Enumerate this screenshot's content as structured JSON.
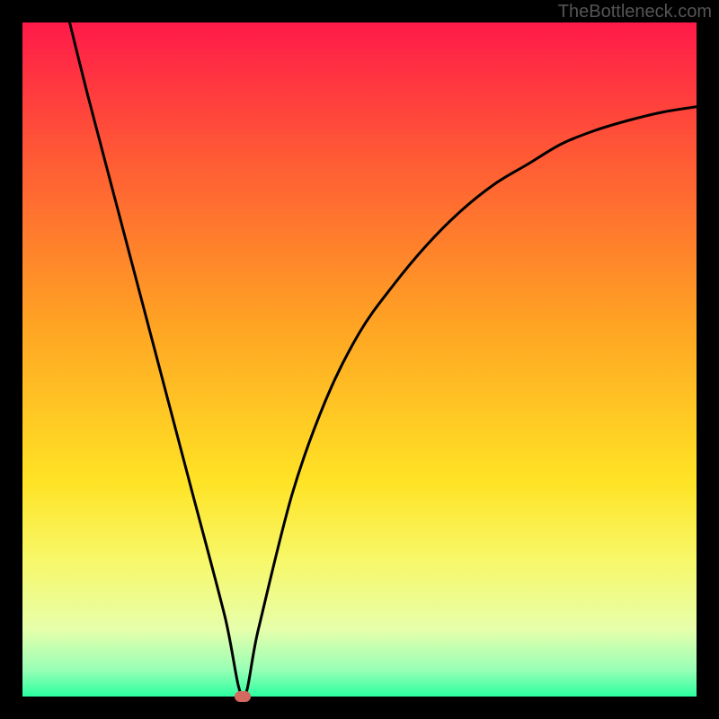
{
  "credit": "TheBottleneck.com",
  "colors": {
    "gradient": [
      "#ff1a49",
      "#ff5a35",
      "#ffa423",
      "#ffe325",
      "#f7f86a",
      "#e7ffab",
      "#99ffb6",
      "#2bffa0"
    ],
    "curve": "#000000",
    "marker": "#d46a5f",
    "background": "#000000"
  },
  "chart_data": {
    "type": "line",
    "title": "",
    "xlabel": "",
    "ylabel": "",
    "xlim": [
      0,
      1
    ],
    "ylim": [
      0,
      1
    ],
    "series": [
      {
        "name": "bottleneck-curve",
        "x": [
          0.07,
          0.1,
          0.15,
          0.2,
          0.25,
          0.3,
          0.327,
          0.35,
          0.4,
          0.45,
          0.5,
          0.55,
          0.6,
          0.65,
          0.7,
          0.75,
          0.8,
          0.85,
          0.9,
          0.95,
          1.0
        ],
        "y": [
          1.0,
          0.88,
          0.69,
          0.5,
          0.31,
          0.12,
          0.0,
          0.1,
          0.3,
          0.44,
          0.54,
          0.61,
          0.67,
          0.72,
          0.76,
          0.79,
          0.82,
          0.84,
          0.855,
          0.867,
          0.875
        ]
      }
    ],
    "marker": {
      "x": 0.327,
      "y": 0.0,
      "color": "#d46a5f"
    },
    "background_gradient_axis": "y",
    "grid": false,
    "legend": false
  }
}
